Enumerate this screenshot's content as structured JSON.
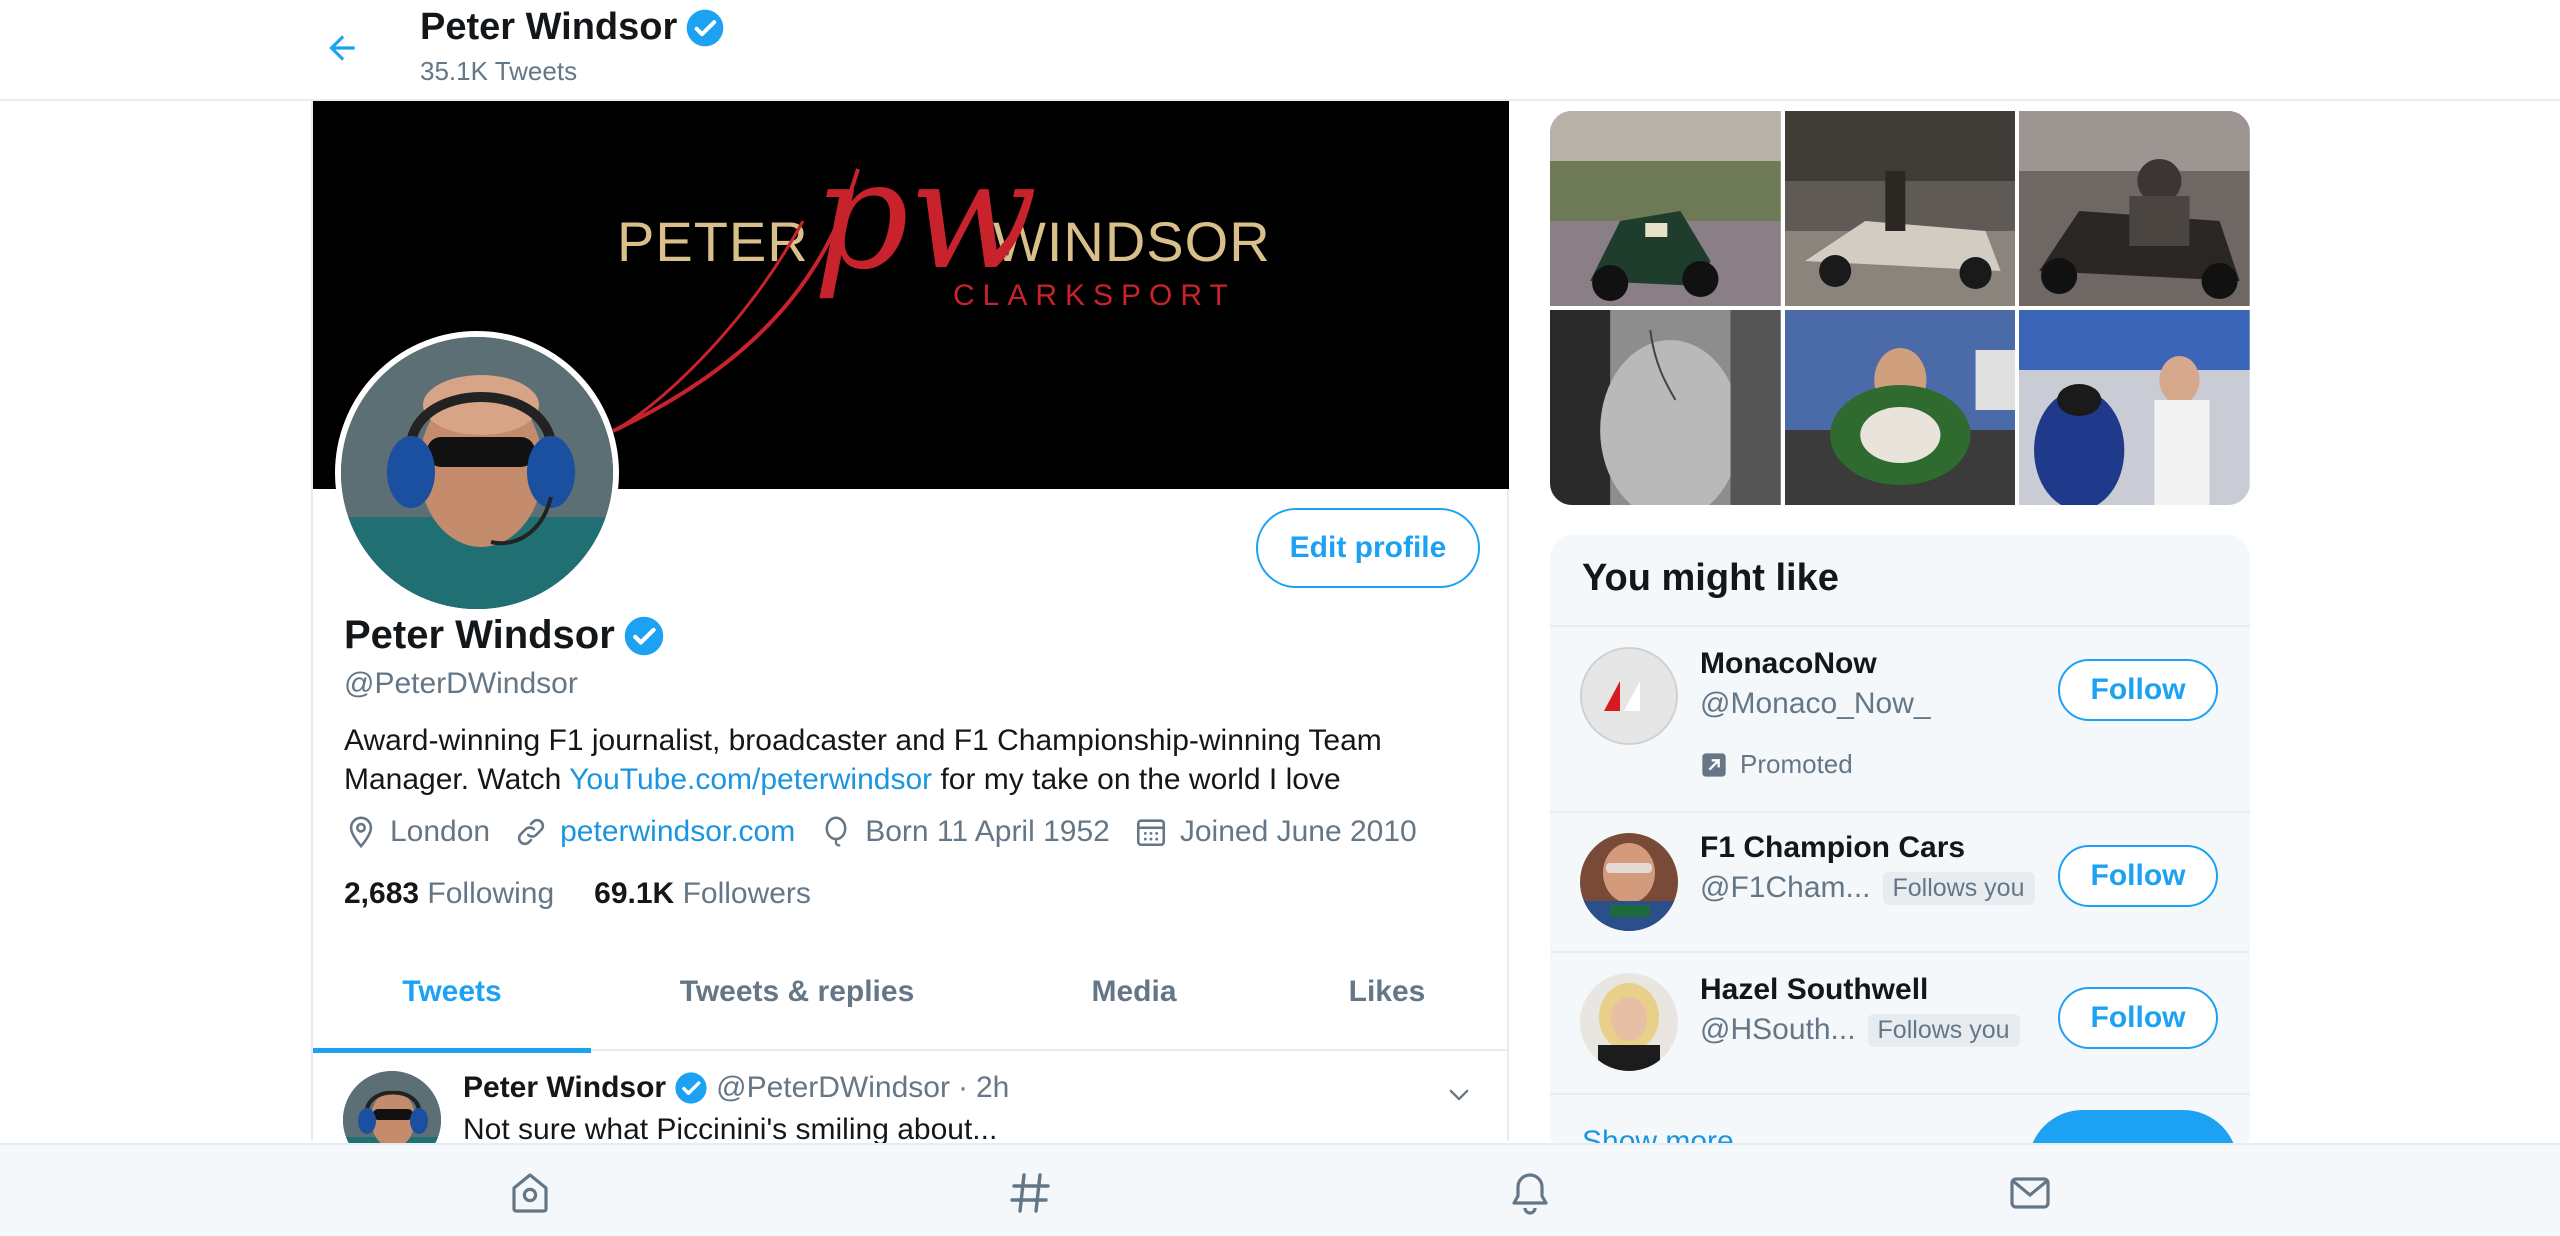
{
  "header": {
    "title": "Peter Windsor",
    "tweet_count": "35.1K Tweets"
  },
  "banner": {
    "left_word": "PETER",
    "monogram": "pw",
    "right_word": "WINDSOR",
    "sub_word": "CLARKSPORT"
  },
  "profile": {
    "name": "Peter Windsor",
    "handle": "@PeterDWindsor",
    "edit_label": "Edit profile",
    "bio_text_1": "Award-winning F1 journalist, broadcaster and F1 Championship-winning Team Manager. Watch ",
    "bio_link": "YouTube.com/peterwindsor",
    "bio_text_2": " for my take on the world I love",
    "location": "London",
    "website": "peterwindsor.com",
    "born": "Born 11 April 1952",
    "joined": "Joined June 2010",
    "following_count": "2,683",
    "following_label": "Following",
    "followers_count": "69.1K",
    "followers_label": "Followers"
  },
  "tabs": [
    {
      "label": "Tweets",
      "active": true
    },
    {
      "label": "Tweets & replies",
      "active": false
    },
    {
      "label": "Media",
      "active": false
    },
    {
      "label": "Likes",
      "active": false
    }
  ],
  "tweet": {
    "name": "Peter Windsor",
    "handle": "@PeterDWindsor",
    "separator": "·",
    "time": "2h",
    "text": "Not sure what Piccinini's smiling about..."
  },
  "suggestions": {
    "title": "You might like",
    "items": [
      {
        "name": "MonacoNow",
        "handle": "@Monaco_Now_",
        "badge": "",
        "promoted": "Promoted",
        "follow_label": "Follow"
      },
      {
        "name": "F1 Champion Cars",
        "handle": "@F1Cham...",
        "badge": "Follows you",
        "promoted": "",
        "follow_label": "Follow"
      },
      {
        "name": "Hazel Southwell",
        "handle": "@HSouth...",
        "badge": "Follows you",
        "promoted": "",
        "follow_label": "Follow"
      }
    ],
    "show_more": "Show more"
  },
  "bottom_nav": [
    "home-icon",
    "explore-hash-icon",
    "notifications-bell-icon",
    "messages-envelope-icon"
  ],
  "colors": {
    "accent": "#1da1f2",
    "link": "#1b95e0",
    "secondary_text": "#657786",
    "banner_gold": "#d9c08a",
    "banner_red": "#c8232c"
  }
}
